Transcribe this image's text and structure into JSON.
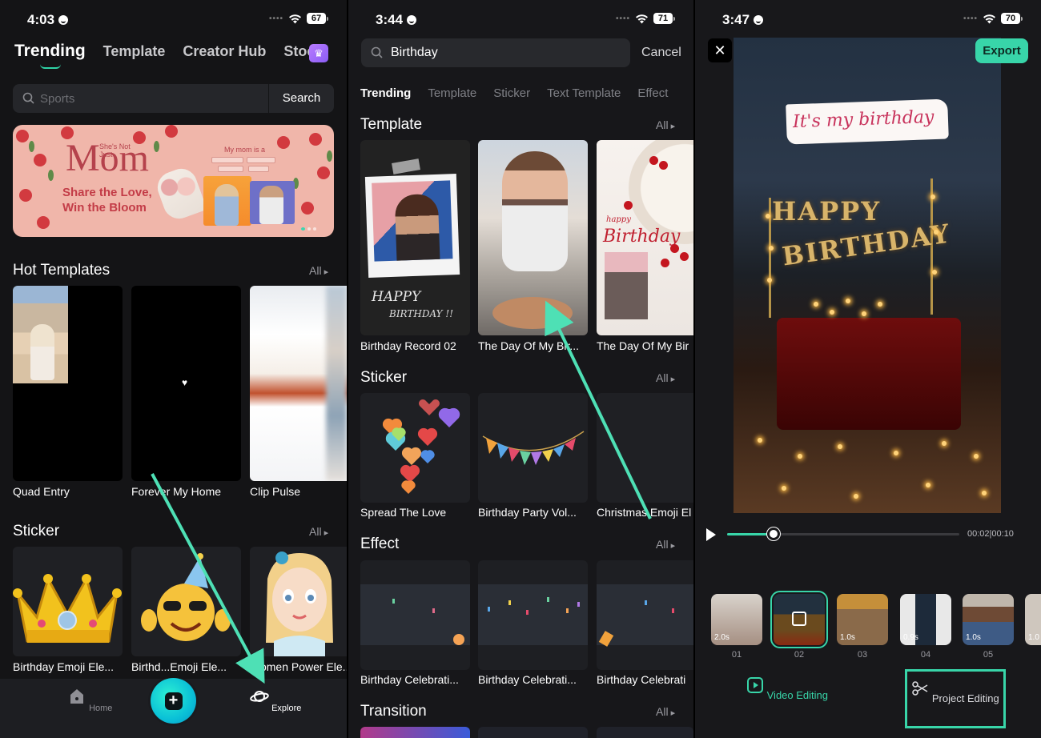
{
  "screens": [
    {
      "status": {
        "time": "4:03",
        "battery": "67"
      },
      "tabs": [
        "Trending",
        "Template",
        "Creator Hub",
        "Stoc"
      ],
      "search": {
        "placeholder": "Sports",
        "button": "Search"
      },
      "banner": {
        "title_big": "Mom",
        "title_small": "She's Not Just",
        "line1": "Share the Love,",
        "line2": "Win the Bloom",
        "mini_title": "My mom is a"
      },
      "hot_templates": {
        "title": "Hot Templates",
        "all": "All",
        "items": [
          {
            "label": "Quad Entry"
          },
          {
            "label": "Forever My Home"
          },
          {
            "label": "Clip Pulse"
          }
        ]
      },
      "sticker": {
        "title": "Sticker",
        "all": "All",
        "items": [
          {
            "label": "Birthday Emoji Ele..."
          },
          {
            "label": "Birthd...Emoji Ele..."
          },
          {
            "label": "Women Power Ele..."
          }
        ]
      },
      "nav": {
        "home": "Home",
        "explore": "Explore"
      }
    },
    {
      "status": {
        "time": "3:44",
        "battery": "71"
      },
      "search": {
        "value": "Birthday"
      },
      "cancel": "Cancel",
      "tabs": [
        "Trending",
        "Template",
        "Sticker",
        "Text Template",
        "Effect"
      ],
      "template": {
        "title": "Template",
        "all": "All",
        "items": [
          {
            "label": "Birthday Record 02"
          },
          {
            "label": "The Day Of My Bir..."
          },
          {
            "label": "The Day Of My Bir"
          }
        ],
        "card_text": {
          "happy": "HAPPY",
          "birthday": "BIRTHDAY !!",
          "cake_small": "happy",
          "cake_word": "Birthday"
        }
      },
      "sticker": {
        "title": "Sticker",
        "all": "All",
        "items": [
          {
            "label": "Spread The Love"
          },
          {
            "label": "Birthday Party Vol..."
          },
          {
            "label": "Christmas Emoji El"
          }
        ]
      },
      "effect": {
        "title": "Effect",
        "all": "All",
        "items": [
          {
            "label": "Birthday Celebrati..."
          },
          {
            "label": "Birthday Celebrati..."
          },
          {
            "label": "Birthday Celebrati"
          }
        ]
      },
      "transition": {
        "title": "Transition",
        "all": "All"
      }
    },
    {
      "status": {
        "time": "3:47",
        "battery": "70"
      },
      "export": "Export",
      "video": {
        "caption": "It's my birthday",
        "balloons_1": "HAPPY",
        "balloons_2": "BIRTHDAY"
      },
      "timeline": {
        "readout": "00:02|00:10",
        "progress": 0.2
      },
      "clips": [
        {
          "num": "01",
          "dur": "2.0s"
        },
        {
          "num": "02",
          "dur": ""
        },
        {
          "num": "03",
          "dur": "1.0s"
        },
        {
          "num": "04",
          "dur": "0.9s"
        },
        {
          "num": "05",
          "dur": "1.0s"
        },
        {
          "num": "",
          "dur": "1.0"
        }
      ],
      "bottom": {
        "video_editing": "Video Editing",
        "project_editing": "Project Editing"
      }
    }
  ],
  "colors": {
    "accent": "#38d5a9",
    "bg": "#141416"
  }
}
